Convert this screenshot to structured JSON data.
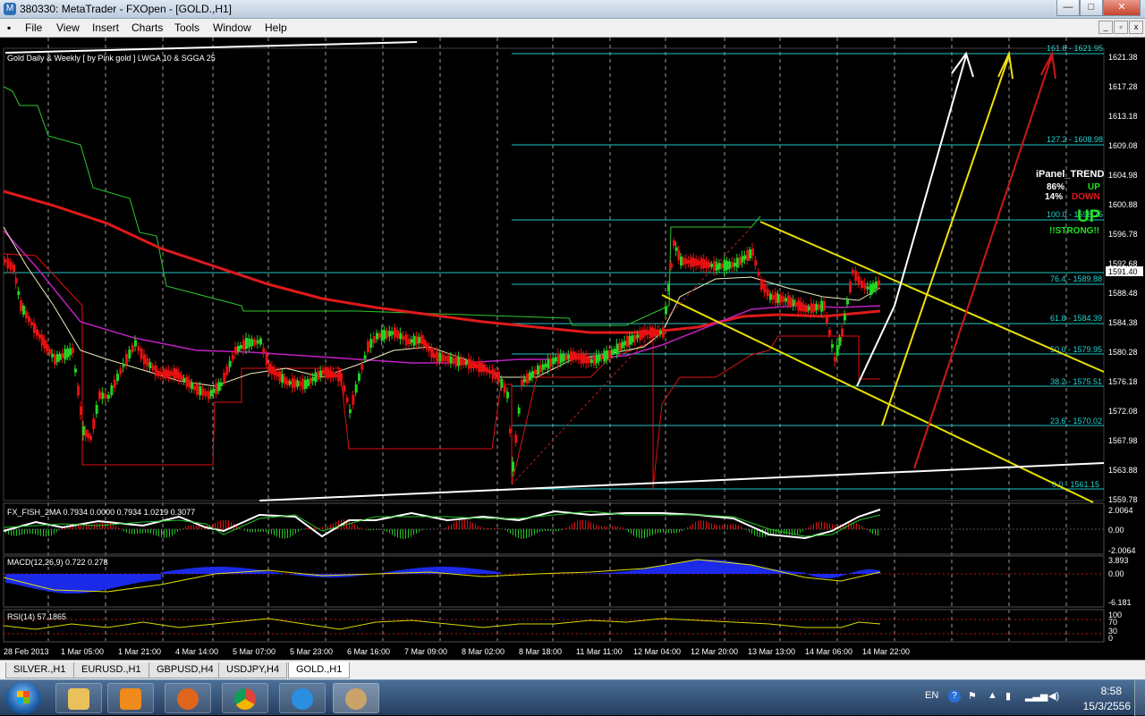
{
  "window": {
    "title": "380330: MetaTrader - FXOpen - [GOLD.,H1]",
    "minimize": "—",
    "maximize": "□",
    "close": "✕"
  },
  "menu": [
    "File",
    "View",
    "Insert",
    "Charts",
    "Tools",
    "Window",
    "Help"
  ],
  "chart": {
    "header": "Gold Daily & Weekly [ by Pink gold ] LWGA 10  &  SGGA 25",
    "current_price": "1591.40",
    "price_axis": [
      "1621.38",
      "1617.28",
      "1613.18",
      "1609.08",
      "1604.98",
      "1600.88",
      "1596.78",
      "1592.68",
      "1588.48",
      "1584.38",
      "1580.28",
      "1576.18",
      "1572.08",
      "1567.98",
      "1563.88",
      "1559.78"
    ],
    "fibo_levels": [
      "161.8 - 1621.95",
      "127.2 - 1608.98",
      "100.0 - 1598.75",
      "76.4 - 1589.88",
      "61.8 - 1584.39",
      "50.0 - 1579.95",
      "38.2 - 1575.51",
      "23.6 - 1570.02",
      "0.0 - 1561.15"
    ],
    "time_axis": [
      "28 Feb 2013",
      "1 Mar 05:00",
      "1 Mar 21:00",
      "4 Mar 14:00",
      "5 Mar 07:00",
      "5 Mar 23:00",
      "6 Mar 16:00",
      "7 Mar 09:00",
      "8 Mar 02:00",
      "8 Mar 18:00",
      "11 Mar 11:00",
      "12 Mar 04:00",
      "12 Mar 20:00",
      "13 Mar 13:00",
      "14 Mar 06:00",
      "14 Mar 22:00"
    ],
    "ipanel": {
      "title": "iPanel_TREND",
      "up_pct": "86%",
      "up_label": "UP",
      "down_pct": "14%",
      "down_label": "DOWN",
      "big": "UP",
      "strong": "!!STRONG!!"
    }
  },
  "indicators": {
    "fish": {
      "label": "FX_FISH_2MA 0.7934 0.0000 0.7934 1.0219 0.3077",
      "axis": [
        "2.0064",
        "0.00",
        "-2.0064"
      ]
    },
    "macd": {
      "label": "MACD(12,26,9) 0.722 0.278",
      "axis": [
        "3.893",
        "0.00",
        "-6.181"
      ]
    },
    "rsi": {
      "label": "RSI(14) 57.1865",
      "axis": [
        "100",
        "70",
        "30",
        "0"
      ]
    }
  },
  "tabs": [
    "SILVER.,H1",
    "EURUSD.,H1",
    "GBPUSD,H4",
    "USDJPY,H4",
    "GOLD.,H1"
  ],
  "active_tab": 4,
  "taskbar": {
    "lang": "EN",
    "time": "8:58",
    "date": "15/3/2556",
    "apps": [
      {
        "name": "file-explorer",
        "color": "#e8c15a"
      },
      {
        "name": "media-player",
        "color": "#f08a1c"
      },
      {
        "name": "firefox",
        "color": "#e0651d"
      },
      {
        "name": "chrome",
        "color": "#3b9e4a"
      },
      {
        "name": "internet-explorer",
        "color": "#2a8fe0"
      },
      {
        "name": "metatrader",
        "color": "#c9a36a"
      }
    ]
  }
}
